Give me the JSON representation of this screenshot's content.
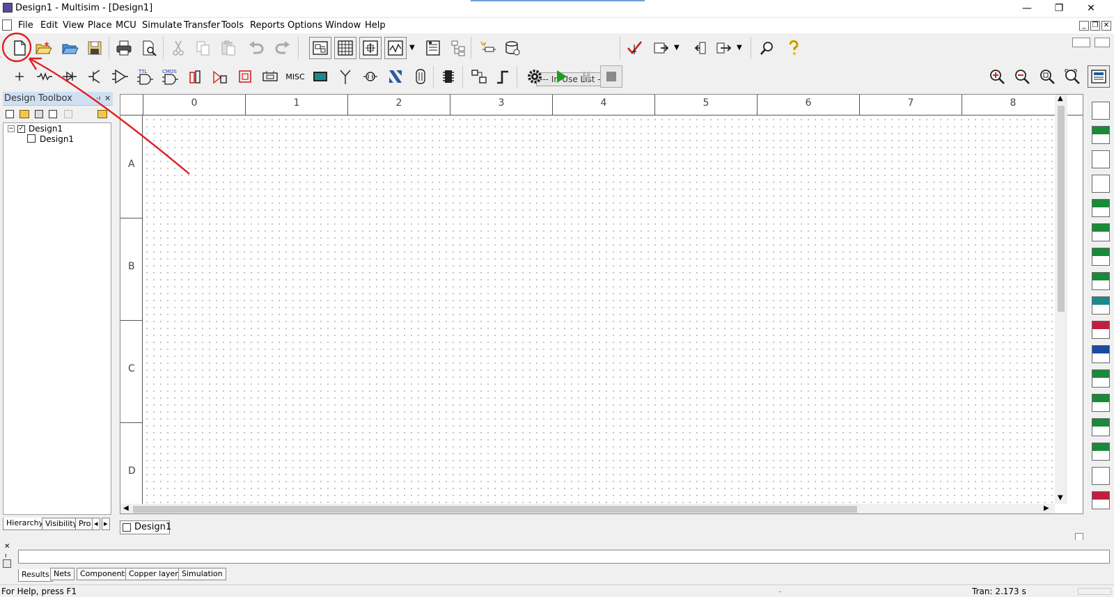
{
  "window": {
    "title": "Design1 - Multisim - [Design1]",
    "minimize": "—",
    "restore": "❐",
    "close": "✕"
  },
  "menu": [
    "File",
    "Edit",
    "View",
    "Place",
    "MCU",
    "Simulate",
    "Transfer",
    "Tools",
    "Reports",
    "Options",
    "Window",
    "Help"
  ],
  "toolbar": {
    "in_use_list": "--- In-Use List ---",
    "misc_label": "MISC"
  },
  "toolbox": {
    "title": "Design Toolbox",
    "tree_root": "Design1",
    "tree_child": "Design1",
    "tabs": [
      "Hierarchy",
      "Visibility",
      "Pro"
    ]
  },
  "canvas": {
    "columns": [
      "0",
      "1",
      "2",
      "3",
      "4",
      "5",
      "6",
      "7",
      "8"
    ],
    "rows": [
      "A",
      "B",
      "C",
      "D"
    ],
    "document_tab": "Design1"
  },
  "spreadsheet": {
    "tabs": [
      "Results",
      "Nets",
      "Components",
      "Copper layers",
      "Simulation"
    ]
  },
  "status": {
    "help": "For Help, press F1",
    "dash": "-",
    "tran": "Tran: 2.173 s"
  },
  "colors": {
    "annotation": "#e02020",
    "toolbox_header": "#cfe0f4",
    "simulate_green": "#1aa01a"
  }
}
